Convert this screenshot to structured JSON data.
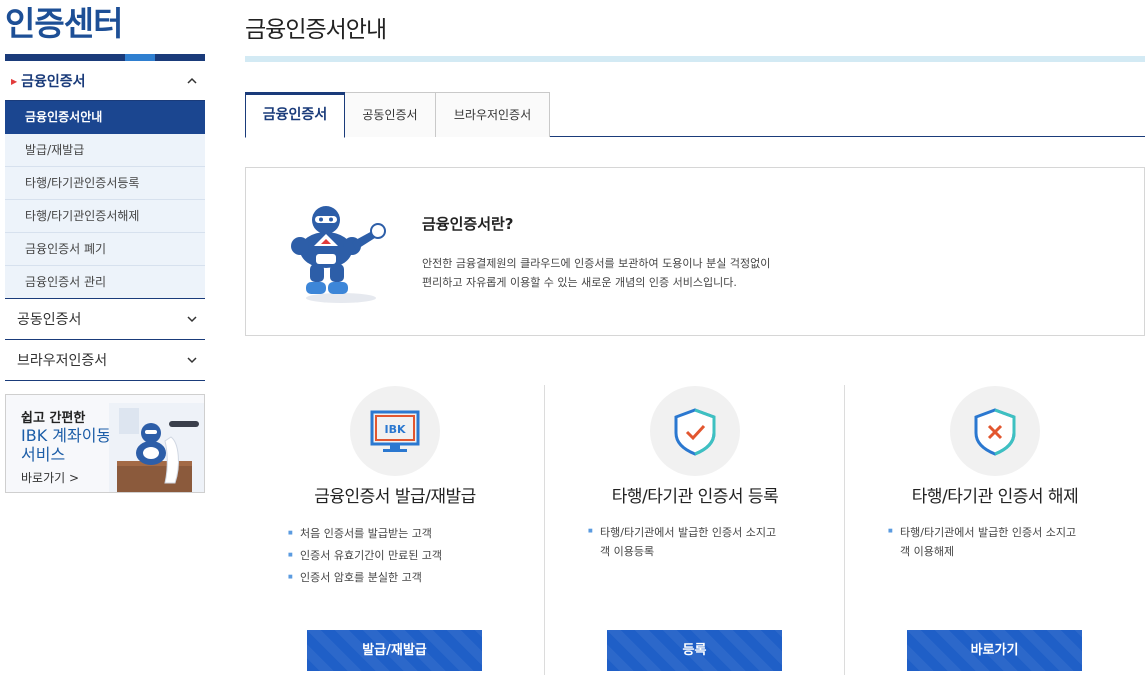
{
  "sidebar": {
    "title": "인증센터",
    "menu_open": "금융인증서",
    "sub_items": [
      "금융인증서안내",
      "발급/재발급",
      "타행/타기관인증서등록",
      "타행/타기관인증서해제",
      "금융인증서 폐기",
      "금융인증서 관리"
    ],
    "menu_rows": [
      "공동인증서",
      "브라우저인증서"
    ],
    "banner": {
      "line1": "쉽고 간편한",
      "line2a": "IBK 계좌이동",
      "line2b": "서비스",
      "link": "바로가기 >"
    }
  },
  "main": {
    "title": "금융인증서안내",
    "tabs": [
      "금융인증서",
      "공동인증서",
      "브라우저인증서"
    ],
    "intro": {
      "heading": "금융인증서란?",
      "line1": "안전한 금융결제원의 클라우드에 인증서를 보관하여 도용이나 분실 걱정없이",
      "line2": "편리하고 자유롭게 이용할 수 있는 새로운 개념의 인증 서비스입니다."
    },
    "cards": [
      {
        "icon": "ibk-monitor-icon",
        "title": "금융인증서 발급/재발급",
        "bullets": [
          "처음 인증서를 발급받는 고객",
          "인증서 유효기간이 만료된 고객",
          "인증서 암호를 분실한 고객"
        ],
        "button": "발급/재발급"
      },
      {
        "icon": "shield-check-icon",
        "title": "타행/타기관 인증서 등록",
        "desc1": "타행/타기관에서 발급한 인증서 소지고",
        "desc2": "객 이용등록",
        "button": "등록"
      },
      {
        "icon": "shield-x-icon",
        "title": "타행/타기관 인증서 해제",
        "desc1": "타행/타기관에서 발급한 인증서 소지고",
        "desc2": "객 이용해제",
        "button": "바로가기"
      }
    ]
  },
  "colors": {
    "brand": "#1a3b7a",
    "button": "#1f5fc7",
    "accent": "#2f7fd0"
  }
}
